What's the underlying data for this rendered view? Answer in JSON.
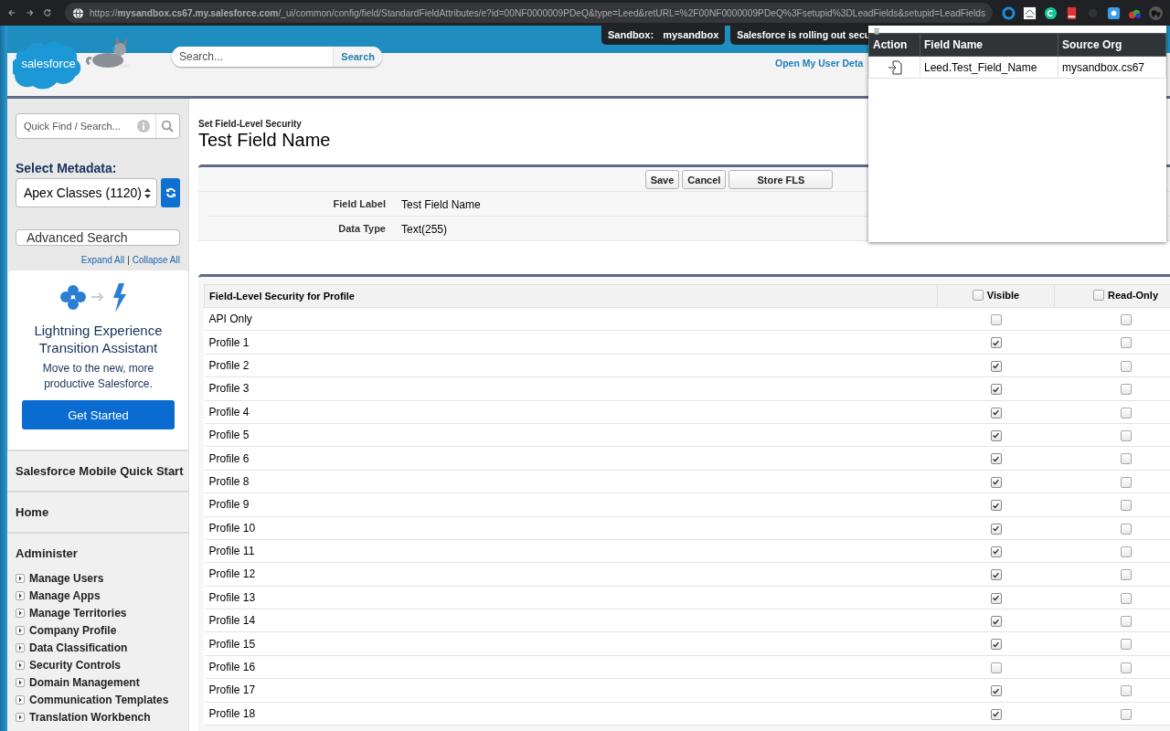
{
  "browser": {
    "url": "https://**mysandbox.cs67.my.salesforce.com**/_ui/common/config/field/StandardFieldAttributes/e?id=00NF0000009PDeQ&type=Leed&retURL=%2F00NF0000009PDeQ%3Fsetupid%3DLeadFields&setupid=LeadFields"
  },
  "header": {
    "logo": "salesforce",
    "search": {
      "placeholder": "Search...",
      "button": "Search"
    },
    "sandbox_label": "Sandbox:",
    "sandbox_name": "mysandbox",
    "notice": "Salesforce is rolling out secu",
    "user_link": "Open My User Deta"
  },
  "popup": {
    "columns": [
      "Action",
      "Field Name",
      "Source Org"
    ],
    "rows": [
      {
        "field_name": "Leed.Test_Field_Name",
        "source_org": "mysandbox.cs67"
      }
    ]
  },
  "sidebar": {
    "quick_find": {
      "placeholder": "Quick Find / Search..."
    },
    "metadata_label": "Select Metadata:",
    "metadata_select": "Apex Classes (1120)",
    "advanced_search": {
      "placeholder": "Advanced Search"
    },
    "expand_all": "Expand All",
    "separator": "|",
    "collapse_all": "Collapse All",
    "promo": {
      "title": "Lightning Experience Transition Assistant",
      "text": "Move to the new, more productive Salesforce.",
      "button": "Get Started"
    },
    "sections": [
      {
        "title": "Salesforce Mobile Quick Start"
      },
      {
        "title": "Home"
      },
      {
        "title": "Administer",
        "items": [
          "Manage Users",
          "Manage Apps",
          "Manage Territories",
          "Company Profile",
          "Data Classification",
          "Security Controls",
          "Domain Management",
          "Communication Templates",
          "Translation Workbench"
        ]
      }
    ]
  },
  "page": {
    "breadcrumb": "Set Field-Level Security",
    "title": "Test Field Name",
    "buttons": [
      "Save",
      "Cancel",
      "Store FLS"
    ],
    "fields": [
      {
        "label": "Field Label",
        "value": "Test Field Name"
      },
      {
        "label": "Data Type",
        "value": "Text(255)"
      }
    ]
  },
  "fls_table": {
    "columns": [
      {
        "label": "Field-Level Security for Profile"
      },
      {
        "label": "Visible",
        "checked": false
      },
      {
        "label": "Read-Only",
        "checked": false
      }
    ],
    "rows": [
      {
        "profile": "API Only",
        "visible": false,
        "read_only": false
      },
      {
        "profile": "Profile 1",
        "visible": true,
        "read_only": false
      },
      {
        "profile": "Profile 2",
        "visible": true,
        "read_only": false
      },
      {
        "profile": "Profile 3",
        "visible": true,
        "read_only": false
      },
      {
        "profile": "Profile 4",
        "visible": true,
        "read_only": false
      },
      {
        "profile": "Profile 5",
        "visible": true,
        "read_only": false
      },
      {
        "profile": "Profile 6",
        "visible": true,
        "read_only": false
      },
      {
        "profile": "Profile 8",
        "visible": true,
        "read_only": false
      },
      {
        "profile": "Profile 9",
        "visible": true,
        "read_only": false
      },
      {
        "profile": "Profile 10",
        "visible": true,
        "read_only": false
      },
      {
        "profile": "Profile 11",
        "visible": true,
        "read_only": false
      },
      {
        "profile": "Profile 12",
        "visible": true,
        "read_only": false
      },
      {
        "profile": "Profile 13",
        "visible": true,
        "read_only": false
      },
      {
        "profile": "Profile 14",
        "visible": true,
        "read_only": false
      },
      {
        "profile": "Profile 15",
        "visible": true,
        "read_only": false
      },
      {
        "profile": "Profile 16",
        "visible": false,
        "read_only": false
      },
      {
        "profile": "Profile 17",
        "visible": true,
        "read_only": false
      },
      {
        "profile": "Profile 18",
        "visible": true,
        "read_only": false
      }
    ]
  }
}
